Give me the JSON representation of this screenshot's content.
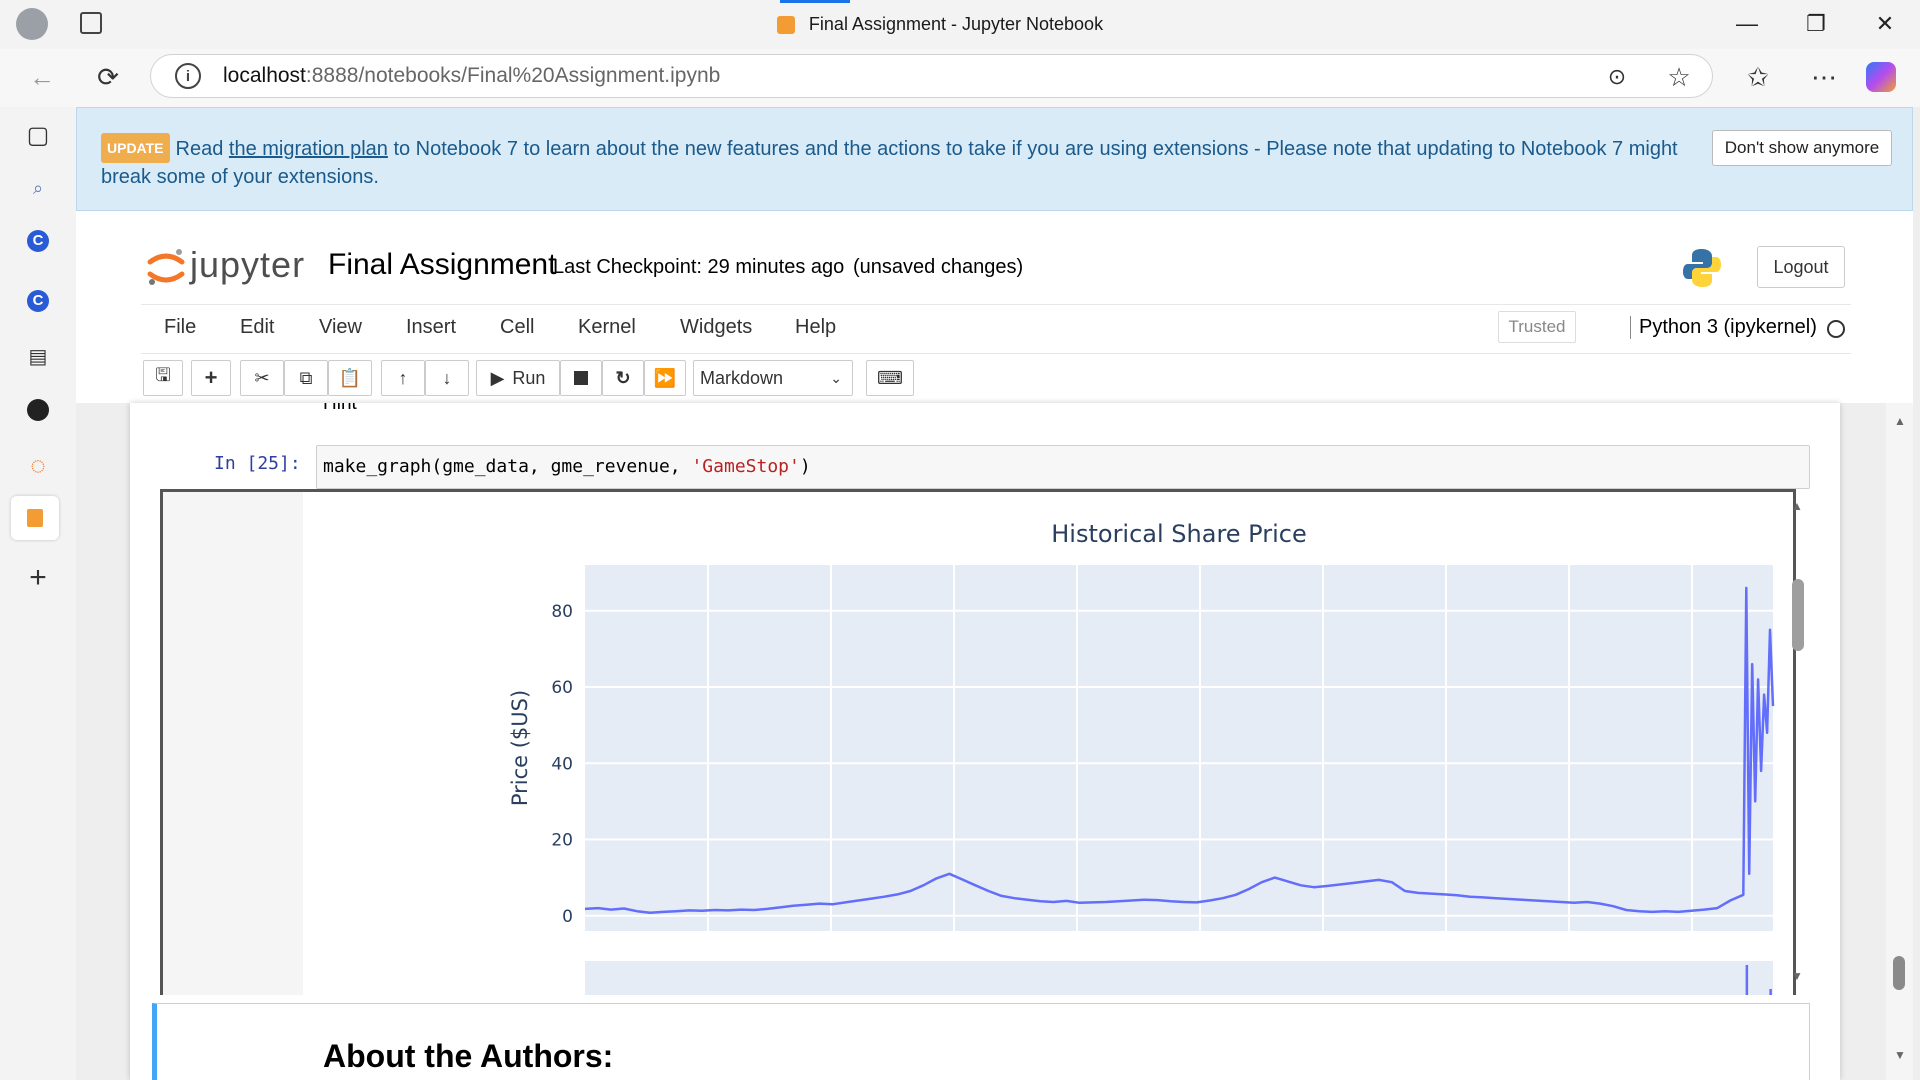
{
  "browser": {
    "tab_title": "Final Assignment - Jupyter Notebook",
    "url_host": "localhost",
    "url_path": ":8888/notebooks/Final%20Assignment.ipynb"
  },
  "banner": {
    "badge": "UPDATE",
    "text_before": "Read ",
    "link": "the migration plan",
    "text_after": " to Notebook 7 to learn about the new features and the actions to take if you are using extensions - Please note that updating to Notebook 7 might break some of your extensions.",
    "dismiss_label": "Don't show anymore"
  },
  "header": {
    "logo_text": "jupyter",
    "notebook_title": "Final Assignment",
    "checkpoint": "Last Checkpoint: 29 minutes ago",
    "unsaved": "(unsaved changes)",
    "logout_label": "Logout"
  },
  "menu": {
    "items": [
      "File",
      "Edit",
      "View",
      "Insert",
      "Cell",
      "Kernel",
      "Widgets",
      "Help"
    ],
    "trusted": "Trusted",
    "kernel_name": "Python 3 (ipykernel)"
  },
  "toolbar": {
    "run_label": "Run",
    "cell_type": "Markdown"
  },
  "cells": {
    "hint_text": "Hint",
    "prompt": "In [25]:",
    "code_before": "make_graph(gme_data, gme_revenue, ",
    "code_string": "'GameStop'",
    "code_after": ")",
    "markdown_heading": "About the Authors:"
  },
  "colors": {
    "accent": "#636efa",
    "plot_bg": "#e5ecf6",
    "banner_bg": "#d8ebf6",
    "prompt": "#303f9f"
  },
  "chart_data": {
    "type": "line",
    "title": "Historical Share Price",
    "ylabel": "Price ($US)",
    "xlabel": "",
    "ylim": [
      -4,
      92
    ],
    "yticks": [
      0,
      20,
      40,
      60,
      80
    ],
    "grid": true,
    "series": [
      {
        "values": [
          1.8,
          2.0,
          1.6,
          1.9,
          1.2,
          0.8,
          1.0,
          1.2,
          1.4,
          1.3,
          1.5,
          1.4,
          1.6,
          1.5,
          1.8,
          2.2,
          2.6,
          2.9,
          3.2,
          3.0,
          3.5,
          4.0,
          4.5,
          5.0,
          5.6,
          6.5,
          8.0,
          9.8,
          11.0,
          9.5,
          8.0,
          6.5,
          5.2,
          4.6,
          4.2,
          3.8,
          3.6,
          3.9,
          3.4,
          3.5,
          3.6,
          3.8,
          4.0,
          4.2,
          4.1,
          3.8,
          3.6,
          3.5,
          4.0,
          4.6,
          5.5,
          7.0,
          8.8,
          10.0,
          9.0,
          8.0,
          7.5,
          7.8,
          8.2,
          8.6,
          9.0,
          9.4,
          8.8,
          6.5,
          6.0,
          5.8,
          5.6,
          5.4,
          5.0,
          4.8,
          4.6,
          4.4,
          4.2,
          4.0,
          3.8,
          3.6,
          3.4,
          3.6,
          3.2,
          2.5,
          1.5,
          1.2,
          1.0,
          1.2,
          1.0,
          1.3,
          1.6,
          2.0,
          4.0,
          5.5,
          86.0,
          11.0,
          66.0,
          30.0,
          62.0,
          38.0,
          58.0,
          48.0,
          75.0,
          55.0
        ]
      }
    ]
  }
}
